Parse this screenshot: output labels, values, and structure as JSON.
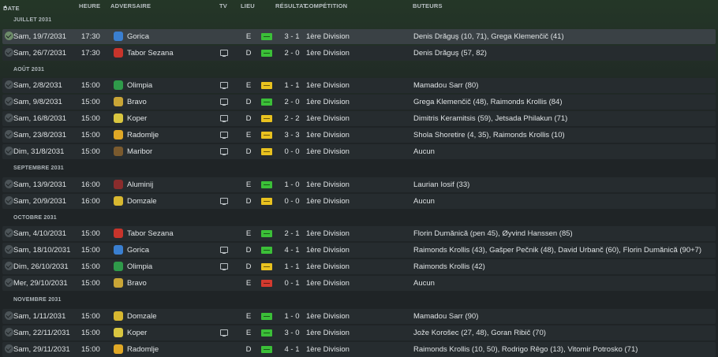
{
  "headers": {
    "date": "DATE",
    "time": "HEURE",
    "opponent": "ADVERSAIRE",
    "tv": "TV",
    "venue": "LIEU",
    "result": "RÉSULTAT",
    "competition": "COMPÉTITION",
    "scorers": "BUTEURS"
  },
  "colors": {
    "win": "#3bbf38",
    "draw": "#e9c21f",
    "loss": "#d43a2f"
  },
  "groups": [
    {
      "label": "JUILLET 2031",
      "matches": [
        {
          "date": "Sam, 19/7/2031",
          "time": "17:30",
          "opponent": "Gorica",
          "crest": "#3a7fd0",
          "tv": false,
          "venue": "E",
          "result": "win",
          "score": "3 - 1",
          "competition": "1ère Division",
          "scorers": "Denis Drăguş (10, 71), Grega Klemenčič (41)",
          "selected": true
        },
        {
          "date": "Sam, 26/7/2031",
          "time": "17:30",
          "opponent": "Tabor Sezana",
          "crest": "#c8342b",
          "tv": true,
          "venue": "D",
          "result": "win",
          "score": "2 - 0",
          "competition": "1ère Division",
          "scorers": "Denis Drăguş (57, 82)"
        }
      ]
    },
    {
      "label": "AOÛT 2031",
      "matches": [
        {
          "date": "Sam, 2/8/2031",
          "time": "15:00",
          "opponent": "Olimpia",
          "crest": "#2f9a4a",
          "tv": true,
          "venue": "E",
          "result": "draw",
          "score": "1 - 1",
          "competition": "1ère Division",
          "scorers": "Mamadou Sarr (80)"
        },
        {
          "date": "Sam, 9/8/2031",
          "time": "15:00",
          "opponent": "Bravo",
          "crest": "#c9a536",
          "tv": true,
          "venue": "D",
          "result": "win",
          "score": "2 - 0",
          "competition": "1ère Division",
          "scorers": "Grega Klemenčič (48), Raimonds Krollis (84)"
        },
        {
          "date": "Sam, 16/8/2031",
          "time": "15:00",
          "opponent": "Koper",
          "crest": "#d9c640",
          "tv": true,
          "venue": "D",
          "result": "draw",
          "score": "2 - 2",
          "competition": "1ère Division",
          "scorers": "Dimitris Keramitsis (59), Jetsada Philakun (71)"
        },
        {
          "date": "Sam, 23/8/2031",
          "time": "15:00",
          "opponent": "Radomlje",
          "crest": "#e0a826",
          "tv": true,
          "venue": "E",
          "result": "draw",
          "score": "3 - 3",
          "competition": "1ère Division",
          "scorers": "Shola Shoretire (4, 35), Raimonds Krollis (10)"
        },
        {
          "date": "Dim, 31/8/2031",
          "time": "15:00",
          "opponent": "Maribor",
          "crest": "#7a5a2e",
          "tv": true,
          "venue": "D",
          "result": "draw",
          "score": "0 - 0",
          "competition": "1ère Division",
          "scorers": "Aucun"
        }
      ]
    },
    {
      "label": "SEPTEMBRE 2031",
      "matches": [
        {
          "date": "Sam, 13/9/2031",
          "time": "16:00",
          "opponent": "Aluminij",
          "crest": "#8a2c2c",
          "tv": false,
          "venue": "E",
          "result": "win",
          "score": "1 - 0",
          "competition": "1ère Division",
          "scorers": "Laurian Iosif (33)"
        },
        {
          "date": "Sam, 20/9/2031",
          "time": "16:00",
          "opponent": "Domzale",
          "crest": "#d8b830",
          "tv": true,
          "venue": "D",
          "result": "draw",
          "score": "0 - 0",
          "competition": "1ère Division",
          "scorers": "Aucun"
        }
      ]
    },
    {
      "label": "OCTOBRE 2031",
      "matches": [
        {
          "date": "Sam, 4/10/2031",
          "time": "15:00",
          "opponent": "Tabor Sezana",
          "crest": "#c8342b",
          "tv": false,
          "venue": "E",
          "result": "win",
          "score": "2 - 1",
          "competition": "1ère Division",
          "scorers": "Florin Dumănică (pen 45), Øyvind Hanssen (85)"
        },
        {
          "date": "Sam, 18/10/2031",
          "time": "15:00",
          "opponent": "Gorica",
          "crest": "#3a7fd0",
          "tv": true,
          "venue": "D",
          "result": "win",
          "score": "4 - 1",
          "competition": "1ère Division",
          "scorers": "Raimonds Krollis (43), Gašper Pečnik (48), David Urbanč (60), Florin Dumănică (90+7)"
        },
        {
          "date": "Dim, 26/10/2031",
          "time": "15:00",
          "opponent": "Olimpia",
          "crest": "#2f9a4a",
          "tv": true,
          "venue": "D",
          "result": "draw",
          "score": "1 - 1",
          "competition": "1ère Division",
          "scorers": "Raimonds Krollis (42)"
        },
        {
          "date": "Mer, 29/10/2031",
          "time": "15:00",
          "opponent": "Bravo",
          "crest": "#c9a536",
          "tv": false,
          "venue": "E",
          "result": "loss",
          "score": "0 - 1",
          "competition": "1ère Division",
          "scorers": "Aucun"
        }
      ]
    },
    {
      "label": "NOVEMBRE 2031",
      "matches": [
        {
          "date": "Sam, 1/11/2031",
          "time": "15:00",
          "opponent": "Domzale",
          "crest": "#d8b830",
          "tv": false,
          "venue": "E",
          "result": "win",
          "score": "1 - 0",
          "competition": "1ère Division",
          "scorers": "Mamadou Sarr (90)"
        },
        {
          "date": "Sam, 22/11/2031",
          "time": "15:00",
          "opponent": "Koper",
          "crest": "#d9c640",
          "tv": true,
          "venue": "E",
          "result": "win",
          "score": "3 - 0",
          "competition": "1ère Division",
          "scorers": "Jože Korošec (27, 48), Goran Ribič (70)"
        },
        {
          "date": "Sam, 29/11/2031",
          "time": "15:00",
          "opponent": "Radomlje",
          "crest": "#e0a826",
          "tv": false,
          "venue": "D",
          "result": "win",
          "score": "4 - 1",
          "competition": "1ère Division",
          "scorers": "Raimonds Krollis (10, 50), Rodrigo Rêgo (13), Vitomir Potrosko (71)"
        }
      ]
    }
  ]
}
